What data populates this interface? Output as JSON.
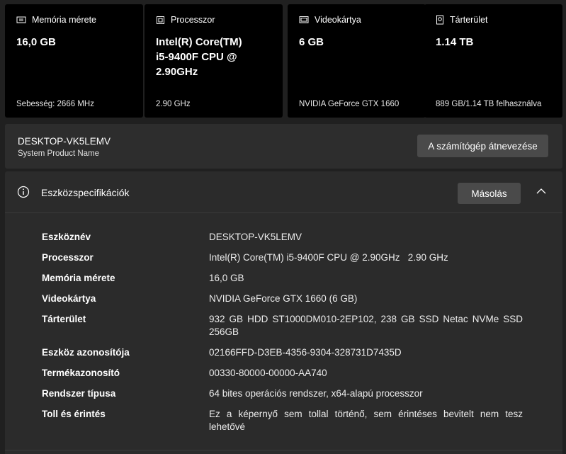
{
  "cards": [
    {
      "icon": "memory-icon",
      "title": "Memória mérete",
      "value": "16,0 GB",
      "sub": "Sebesség: 2666 MHz"
    },
    {
      "icon": "processor-icon",
      "title": "Processzor",
      "value": "Intel(R) Core(TM)\ni5-9400F CPU @\n2.90GHz",
      "sub": "2.90 GHz"
    },
    {
      "icon": "graphics-card-icon",
      "title": "Videokártya",
      "value": "6 GB",
      "sub": "NVIDIA GeForce GTX 1660"
    },
    {
      "icon": "storage-icon",
      "title": "Tárterület",
      "value": "1.14 TB",
      "sub": "889 GB/1.14 TB felhasználva"
    }
  ],
  "device": {
    "name": "DESKTOP-VK5LEMV",
    "model": "System Product Name",
    "rename_label": "A számítógép átnevezése"
  },
  "specs": {
    "title": "Eszközspecifikációk",
    "copy_label": "Másolás",
    "rows": [
      {
        "label": "Eszköznév",
        "value": "DESKTOP-VK5LEMV"
      },
      {
        "label": "Processzor",
        "value": "Intel(R) Core(TM) i5-9400F CPU @ 2.90GHz   2.90 GHz"
      },
      {
        "label": "Memória mérete",
        "value": "16,0 GB"
      },
      {
        "label": "Videokártya",
        "value": "NVIDIA GeForce GTX 1660 (6 GB)"
      },
      {
        "label": "Tárterület",
        "value": "932 GB HDD ST1000DM010-2EP102, 238 GB SSD Netac NVMe SSD 256GB"
      },
      {
        "label": "Eszköz azonosítója",
        "value": "02166FFD-D3EB-4356-9304-328731D7435D"
      },
      {
        "label": "Termékazonosító",
        "value": "00330-80000-00000-AA740"
      },
      {
        "label": "Rendszer típusa",
        "value": "64 bites operációs rendszer, x64-alapú processzor"
      },
      {
        "label": "Toll és érintés",
        "value": "Ez a képernyő sem tollal történő, sem érintéses bevitelt nem tesz lehetővé"
      }
    ]
  }
}
